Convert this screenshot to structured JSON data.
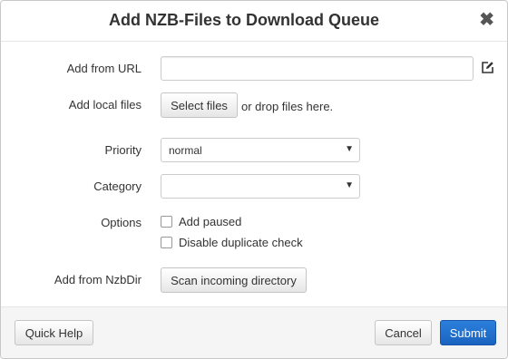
{
  "dialog": {
    "title": "Add NZB-Files to Download Queue",
    "close_glyph": "✖"
  },
  "url": {
    "label": "Add from URL",
    "value": "",
    "edit_icon": "edit-icon"
  },
  "local_files": {
    "label": "Add local files",
    "button_label": "Select files",
    "hint": "or drop files here."
  },
  "priority": {
    "label": "Priority",
    "selected": "normal"
  },
  "category": {
    "label": "Category",
    "selected": ""
  },
  "options": {
    "label": "Options",
    "add_paused": "Add paused",
    "disable_dup": "Disable duplicate check"
  },
  "nzbdir": {
    "label": "Add from NzbDir",
    "button_label": "Scan incoming directory"
  },
  "footer": {
    "quick_help": "Quick Help",
    "cancel": "Cancel",
    "submit": "Submit"
  },
  "colors": {
    "primary": "#1a63c0"
  }
}
